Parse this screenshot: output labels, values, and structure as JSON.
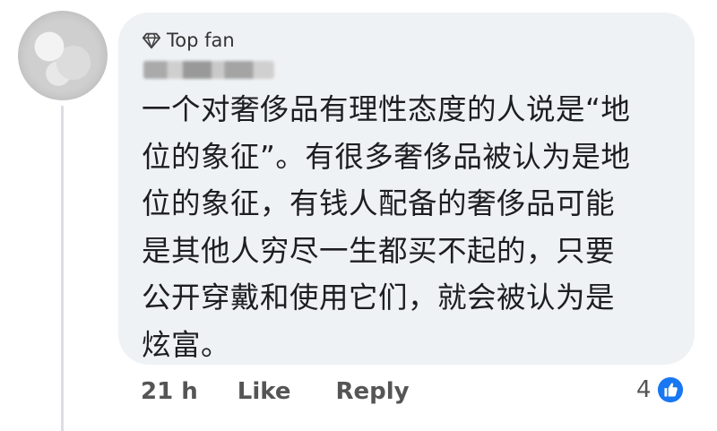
{
  "comment": {
    "badge_label": "Top fan",
    "text": "一个对奢侈品有理性态度的人说是“地\n位的象征”。有很多奢侈品被认为是地\n位的象征，有钱人配备的奢侈品可能\n是其他人穷尽一生都买不起的，只要\n公开穿戴和使用它们，就会被认为是\n炫富。"
  },
  "actions": {
    "timestamp": "21 h",
    "like_label": "Like",
    "reply_label": "Reply"
  },
  "reactions": {
    "count": "4",
    "icon": "like-icon",
    "color": "#1877f2"
  },
  "colors": {
    "bubble": "#eff2f5",
    "text": "#1c1e21",
    "muted": "#555555"
  }
}
